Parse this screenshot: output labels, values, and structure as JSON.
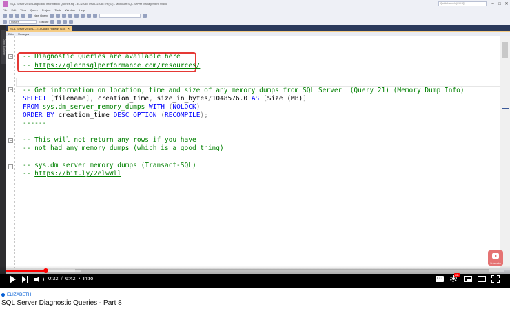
{
  "window": {
    "title": "SQL Server 2019 Diagnostic Information Queries.sql - ELIZABETH\\ELIZABETH (63) - Microsoft SQL Server Management Studio",
    "quick_launch_placeholder": "Quick Launch (Ctrl+Q)",
    "controls": [
      "–",
      "□",
      "✕"
    ]
  },
  "menu": [
    "File",
    "Edit",
    "View",
    "Query",
    "Project",
    "Tools",
    "Window",
    "Help"
  ],
  "toolbar": {
    "new_query_label": "New Query",
    "database_value": "master",
    "execute_label": "Execute"
  },
  "sidebar": {
    "object_explorer_label": "Object Explorer"
  },
  "tab": {
    "label": "SQL Server 2019 D...ELIZABETH\\glenn (63))",
    "close": "×"
  },
  "results_bar": [
    "Editor",
    "Messages"
  ],
  "editor": {
    "lines": [
      {
        "segments": [
          {
            "cls": "c-comment",
            "text": "-- Diagnostic Queries are available here"
          }
        ]
      },
      {
        "segments": [
          {
            "cls": "c-comment",
            "text": "-- "
          },
          {
            "cls": "c-link",
            "text": "https://glennsqlperformance.com/resources/"
          }
        ]
      },
      {
        "segments": [
          {
            "cls": "c-comment",
            "text": "-- Get information on location, time and size of any memory dumps from SQL Server  (Query 21) (Memory Dump Info)"
          }
        ]
      },
      {
        "segments": [
          {
            "cls": "c-kw",
            "text": "SELECT "
          },
          {
            "cls": "c-gray",
            "text": "["
          },
          {
            "cls": "c-text",
            "text": "filename"
          },
          {
            "cls": "c-gray",
            "text": "], "
          },
          {
            "cls": "c-text",
            "text": "creation_time"
          },
          {
            "cls": "c-gray",
            "text": ", "
          },
          {
            "cls": "c-text",
            "text": "size_in_bytes"
          },
          {
            "cls": "c-gray",
            "text": "/"
          },
          {
            "cls": "c-text",
            "text": "1048576.0 "
          },
          {
            "cls": "c-kw",
            "text": "AS "
          },
          {
            "cls": "c-gray",
            "text": "["
          },
          {
            "cls": "c-text",
            "text": "Size (MB)"
          },
          {
            "cls": "c-gray",
            "text": "]"
          }
        ]
      },
      {
        "segments": [
          {
            "cls": "c-kw",
            "text": "FROM "
          },
          {
            "cls": "c-sys",
            "text": "sys.dm_server_memory_dumps "
          },
          {
            "cls": "c-kw",
            "text": "WITH "
          },
          {
            "cls": "c-gray",
            "text": "("
          },
          {
            "cls": "c-kw",
            "text": "NOLOCK"
          },
          {
            "cls": "c-gray",
            "text": ")"
          }
        ]
      },
      {
        "segments": [
          {
            "cls": "c-kw",
            "text": "ORDER BY "
          },
          {
            "cls": "c-text",
            "text": "creation_time "
          },
          {
            "cls": "c-kw",
            "text": "DESC OPTION "
          },
          {
            "cls": "c-gray",
            "text": "("
          },
          {
            "cls": "c-kw",
            "text": "RECOMPILE"
          },
          {
            "cls": "c-gray",
            "text": ");"
          }
        ]
      },
      {
        "segments": [
          {
            "cls": "c-comment",
            "text": "------"
          }
        ]
      },
      {
        "segments": [
          {
            "cls": "c-comment",
            "text": "-- This will not return any rows if you have"
          }
        ]
      },
      {
        "segments": [
          {
            "cls": "c-comment",
            "text": "-- not had any memory dumps (which is a good thing)"
          }
        ]
      },
      {
        "segments": [
          {
            "cls": "c-comment",
            "text": "-- sys.dm_server_memory_dumps (Transact-SQL)"
          }
        ]
      },
      {
        "segments": [
          {
            "cls": "c-comment",
            "text": "-- "
          },
          {
            "cls": "c-link",
            "text": "https://bit.ly/2elwWll"
          }
        ]
      }
    ]
  },
  "player": {
    "current_time": "0:32",
    "duration": "6:42",
    "chapter": "Intro",
    "progress_fraction": 0.08,
    "buffer_fraction": 0.15,
    "subscribe_label": "Subscribe",
    "cc_label": "CC",
    "hd_badge": "HD",
    "accent_color": "#ff0000"
  },
  "channel": {
    "name": "ELIZABETH"
  },
  "video": {
    "title": "SQL Server Diagnostic Queries - Part 8"
  }
}
